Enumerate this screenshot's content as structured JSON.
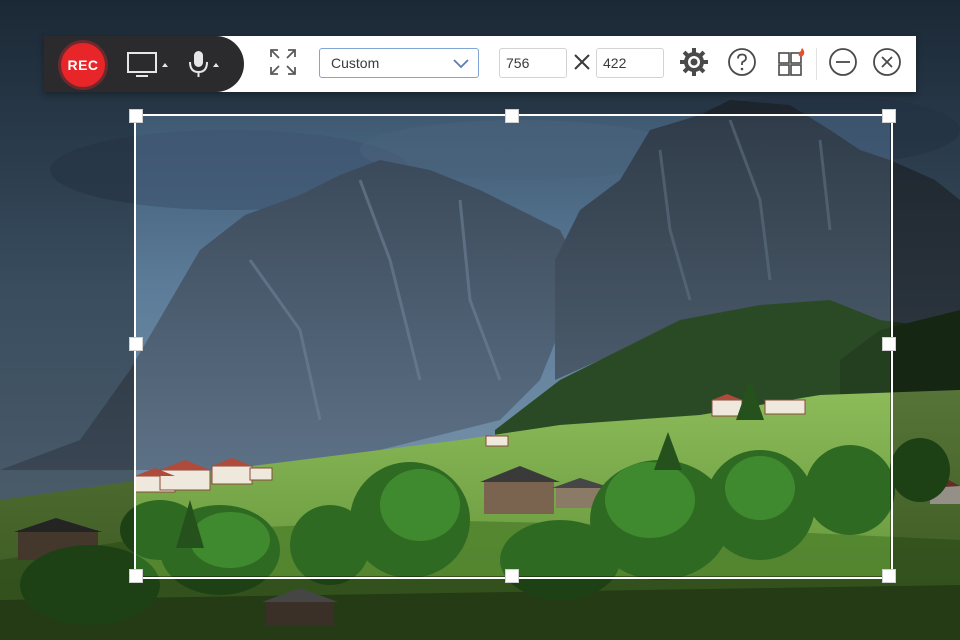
{
  "toolbar": {
    "rec_label": "REC",
    "icons": {
      "display": "monitor-icon",
      "microphone": "microphone-icon",
      "fullscreen": "expand-arrows-icon",
      "settings": "gear-icon",
      "help": "question-icon",
      "toolbox": "grid-icon",
      "minimize": "minimize-icon",
      "close": "close-icon"
    },
    "preset_value": "Custom",
    "width_value": "756",
    "height_value": "422",
    "times_symbol": "×"
  },
  "colors": {
    "rec": "#e8262a",
    "dark_panel": "#2b2b2e",
    "select_border": "#7fa6d6",
    "icon": "#4a4a4a",
    "badge_flame": "#e8502a"
  }
}
